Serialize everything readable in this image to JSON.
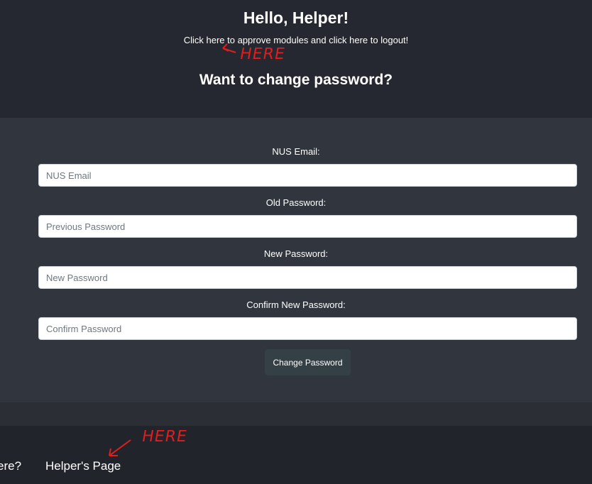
{
  "header": {
    "greeting": "Hello, Helper!",
    "intro_prefix": "Click ",
    "approve_link": "here",
    "intro_middle": " to approve modules and click ",
    "logout_link": "here",
    "intro_suffix": " to logout!",
    "section_title": "Want to change password?"
  },
  "form": {
    "email": {
      "label": "NUS Email:",
      "placeholder": "NUS Email"
    },
    "old_password": {
      "label": "Old Password:",
      "placeholder": "Previous Password"
    },
    "new_password": {
      "label": "New Password:",
      "placeholder": "New Password"
    },
    "confirm_password": {
      "label": "Confirm New Password:",
      "placeholder": "Confirm Password"
    },
    "submit_label": "Change Password"
  },
  "footer": {
    "prev_link": "ere?",
    "helper_link": "Helper's Page"
  },
  "annotations": {
    "note_1": "HERE",
    "note_2": "HERE",
    "color": "#e11d1d"
  },
  "colors": {
    "header_bg": "#252830",
    "form_bg": "#30353e",
    "footer_bg": "#22242b",
    "button_bg": "#353f46"
  }
}
